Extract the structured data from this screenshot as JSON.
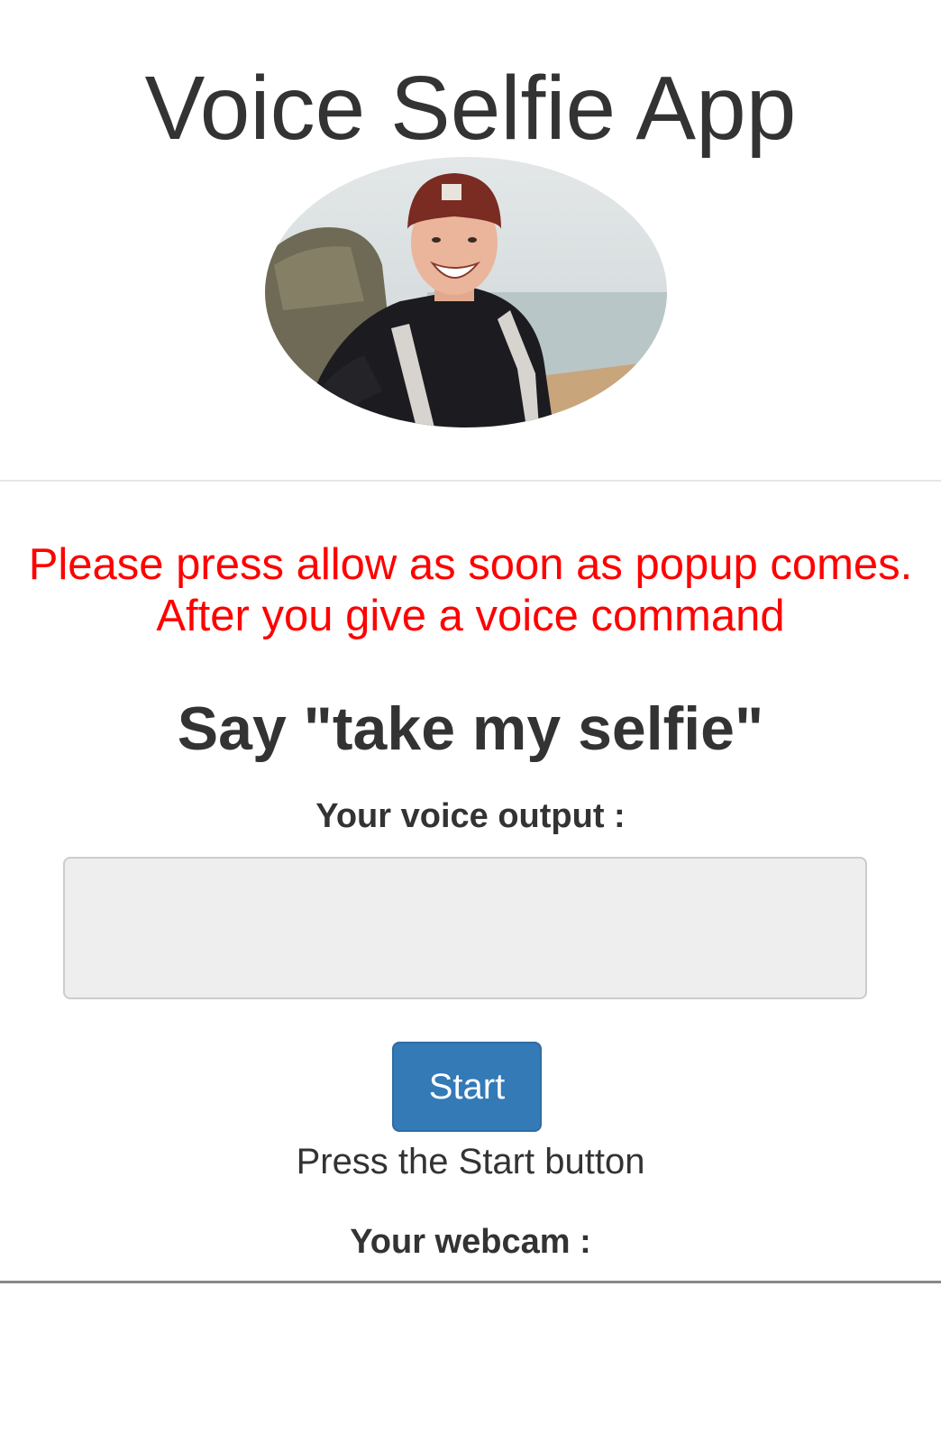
{
  "header": {
    "title": "Voice Selfie App",
    "hero_image": "smiling-man-selfie-photo"
  },
  "notice": {
    "text": "Please press allow as soon as popup comes. After you give a voice command",
    "color": "#ff0000"
  },
  "main": {
    "instruction": "Say \"take my selfie\"",
    "output_label": "Your voice output :",
    "output_value": "",
    "start_label": "Start",
    "status": "Press the Start button",
    "webcam_label": "Your webcam :"
  },
  "colors": {
    "primary_button": "#337ab7",
    "text": "#333333",
    "output_box_bg": "#eeeeee"
  }
}
